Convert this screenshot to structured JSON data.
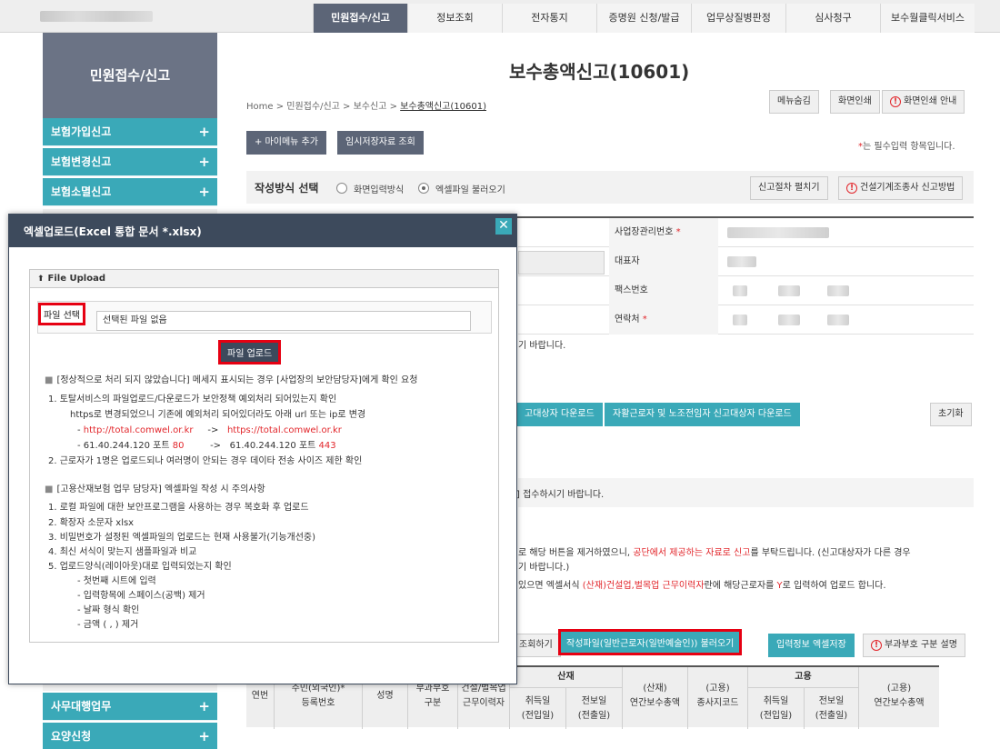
{
  "top_nav": {
    "tabs": [
      "민원접수/신고",
      "정보조회",
      "전자통지",
      "증명원 신청/발급",
      "업무상질병판정",
      "심사청구",
      "보수월클릭서비스"
    ]
  },
  "sidebar": {
    "title": "민원접수/신고",
    "items": [
      "보험가입신고",
      "보험변경신고",
      "보험소멸신고"
    ],
    "bottom_items": [
      "사무대행업무",
      "요양신청"
    ]
  },
  "main": {
    "title": "보수총액신고(10601)",
    "breadcrumb": [
      "Home",
      "민원접수/신고",
      "보수신고",
      "보수총액신고(10601)"
    ],
    "menu_hide": "메뉴숨김",
    "screen_print": "화면인쇄",
    "screen_print_guide": "화면인쇄 안내",
    "add_my_menu": "+ 마이메뉴 추가",
    "temp_saved": "임시저장자료 조회",
    "required_note_star": "*",
    "required_note": "는 필수입력 항목입니다.",
    "method_label": "작성방식 선택",
    "method_options": [
      "화면입력방식",
      "엑셀파일 불러오기"
    ],
    "procedure_btn": "신고절차 펼치기",
    "construction_btn": "건설기계조종사 신고방법",
    "form_labels": [
      "사업장관리번호",
      "대표자",
      "팩스번호",
      "연락처"
    ],
    "required_star": "*",
    "peek_text_1": "기 바랍니다.",
    "download_btn_1": "고대상자 다운로드",
    "download_btn_2": "자활근로자 및 노조전임자 신고대상자 다운로드",
    "reset_btn": "초기화",
    "peek_text_2": "] 접수하시기 바랍니다.",
    "peek_text_3a": "로 해당 버튼을 제거하였으니, ",
    "peek_text_3b": "공단에서 제공하는 자료로 신고",
    "peek_text_3c": "를 부탁드립니다. (신고대상자가 다른 경우",
    "peek_text_4": "기 바랍니다.)",
    "peek_text_5a": "있으면 엑셀서식 ",
    "peek_text_5b": "(산재)건설업,벌목업 근무이력자",
    "peek_text_5c": "란에 해당근로자를 ",
    "peek_text_5d": "Y",
    "peek_text_5e": "로 입력하여 업로드 합니다.",
    "query_btn": "조회하기",
    "load_btn": "작성파일(일반근로자(일반예술인)) 불러오기",
    "save_excel_btn": "입력정보 엑셀저장",
    "tax_btn": "부과부호 구분 설명"
  },
  "table_header": {
    "serial": "연번",
    "resident_no_1": "주민(외국인)*",
    "resident_no_2": "등록번호",
    "name": "성명",
    "tax_code_1": "부과부호",
    "tax_code_2": "구분",
    "construction_1": "건설/벌목업",
    "construction_2": "근무이력자",
    "sanjae": "산재",
    "acq_date_1": "취득일",
    "acq_date_2": "(전입일)",
    "transfer_date_1": "전보일",
    "transfer_date_2": "(전출일)",
    "sanjae_total_1": "(산재)",
    "sanjae_total_2": "연간보수총액",
    "employment_code_1": "(고용)",
    "employment_code_2": "종사지코드",
    "goyong": "고용",
    "g_acq_1": "취득일",
    "g_acq_2": "(전입일)",
    "g_transfer_1": "전보일",
    "g_transfer_2": "(전출일)",
    "goyong_total_1": "(고용)",
    "goyong_total_2": "연간보수총액"
  },
  "modal": {
    "title": "엑셀업로드(Excel 통합 문서 *.xlsx)",
    "close": "✕",
    "panel_title": "File Upload",
    "file_select": "파일 선택",
    "file_none": "선택된 파일 없음",
    "upload_btn": "파일 업로드",
    "n1_title": "[정상적으로 처리 되지 않았습니다] 메세지 표시되는 경우 [사업장의 보안담당자]에게 확인 요청",
    "n1_1": "1.   토탈서비스의 파일업로드/다운로드가 보안정책 예외처리 되어있는지 확인",
    "n1_1b": "https로 변경되었으니 기존에 예외처리 되어있더라도 아래 url 또는 ip로 변경",
    "n1_url_prefix": "- ",
    "n1_url_old": "http://total.comwel.or.kr",
    "n1_arrow": "->",
    "n1_url_new": "https://total.comwel.or.kr",
    "n1_ip_old": "- 61.40.244.120 포트 ",
    "n1_port_old": "80",
    "n1_ip_new": "61.40.244.120 포트 ",
    "n1_port_new": "443",
    "n1_2": "2.   근로자가 1명은 업로드되나 여러명이 안되는 경우 데이타 전송 사이즈 제한 확인",
    "n2_title": "[고용산재보험 업무 담당자] 엑셀파일 작성 시 주의사항",
    "n2_1": "1.   로컬 파일에 대한 보안프로그램을 사용하는 경우 복호화 후 업로드",
    "n2_2": "2.   확장자 소문자 xlsx",
    "n2_3": "3.   비밀번호가 설정된 엑셀파일의 업로드는 현재 사용불가(기능개선중)",
    "n2_4": "4.   최신 서식이 맞는지 샘플파일과 비교",
    "n2_5": "5.   업로드양식(레이아웃)대로 입력되었는지 확인",
    "n2_5a": "- 첫번째 시트에 입력",
    "n2_5b": "- 입력항목에 스페이스(공백) 제거",
    "n2_5c": "- 날짜 형식 확인",
    "n2_5d": "- 금액 ( , ) 제거"
  },
  "colors": {
    "accent_teal": "#3aa9b8",
    "nav_dark": "#5c6577",
    "modal_header": "#3d4a5c",
    "highlight_red": "#e60012",
    "required_red": "#e2262b"
  }
}
